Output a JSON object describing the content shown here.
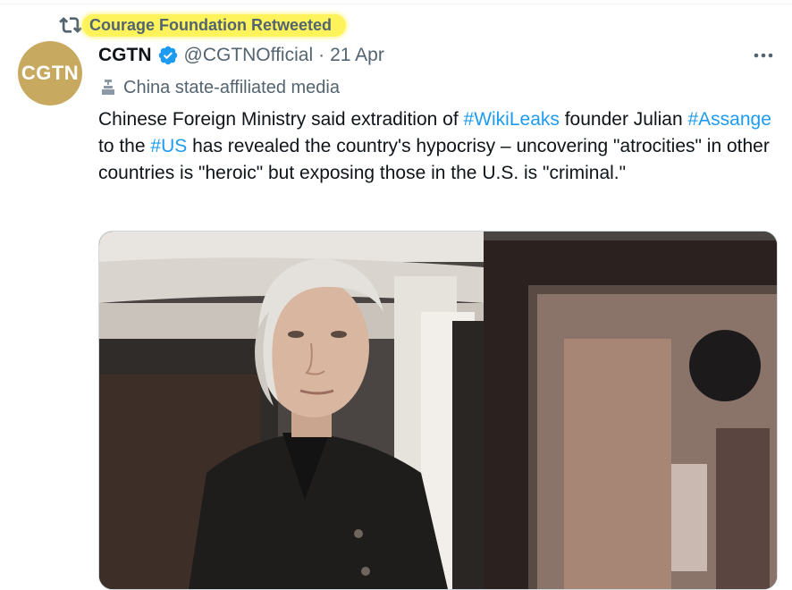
{
  "social_context": {
    "label": "Courage Foundation Retweeted",
    "icon": "retweet-icon"
  },
  "author": {
    "avatar_text": "CGTN",
    "avatar_color": "#c8a960",
    "display_name": "CGTN",
    "verified": true,
    "handle": "@CGTNOfficial",
    "separator": "·",
    "date": "21 Apr",
    "affiliation": "China state-affiliated media",
    "affiliation_icon": "podium-icon"
  },
  "tweet": {
    "segments": [
      {
        "text": "Chinese Foreign Ministry said extradition of ",
        "type": "text"
      },
      {
        "text": "#WikiLeaks",
        "type": "hashtag"
      },
      {
        "text": " founder Julian ",
        "type": "text"
      },
      {
        "text": "#Assange",
        "type": "hashtag"
      },
      {
        "text": " to the ",
        "type": "text"
      },
      {
        "text": "#US",
        "type": "hashtag"
      },
      {
        "text": " has revealed the country's hypocrisy – uncovering \"atrocities\" in other countries is \"heroic\" but exposing those in the U.S. is \"criminal.\"",
        "type": "text"
      }
    ],
    "more_icon": "more-options-icon"
  },
  "media": {
    "type": "photo",
    "icon": "photo-image"
  },
  "colors": {
    "link": "#1d9bf0",
    "secondary_text": "#536471",
    "verified": "#1d9bf0",
    "highlight": "#fff35c"
  }
}
